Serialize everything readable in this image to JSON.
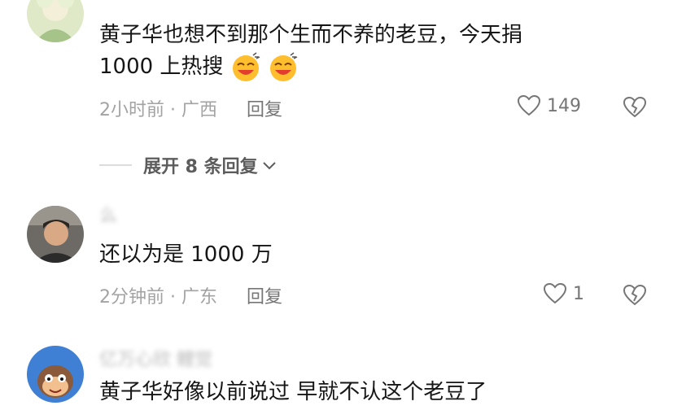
{
  "comments": [
    {
      "text_line1": "黄子华也想不到那个生而不养的老豆，今天捐",
      "text_line2": "1000 上热搜",
      "emoji": "laughing-tears-emoji",
      "time": "2小时前 · 广西",
      "reply_label": "回复",
      "likes": "149"
    },
    {
      "username": "么",
      "text_line1": "还以为是 1000 万",
      "time": "2分钟前 · 广东",
      "reply_label": "回复",
      "likes": "1"
    },
    {
      "username": "亿万心欣 鲤觉",
      "text_line1": "黄子华好像以前说过 早就不认这个老豆了"
    }
  ],
  "expand_replies": "展开 8 条回复",
  "icons": {
    "like": "heart-outline-icon",
    "dislike": "broken-heart-icon",
    "expand": "chevron-down-icon"
  },
  "colors": {
    "text": "#161616",
    "meta": "#a3a3a3",
    "action": "#767676"
  }
}
